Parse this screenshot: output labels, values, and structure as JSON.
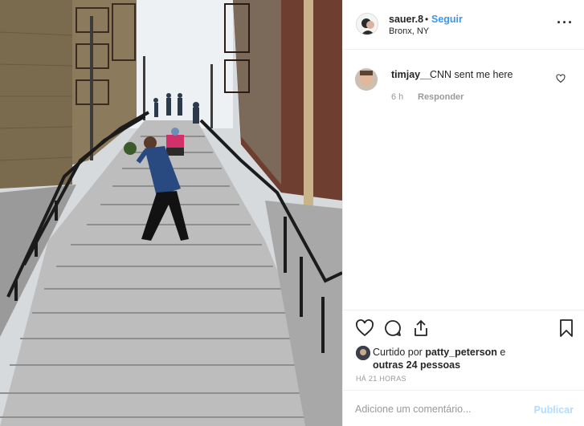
{
  "post": {
    "username": "sauer.8",
    "separator": "•",
    "follow_label": "Seguir",
    "location": "Bronx, NY",
    "more_icon": "more-horizontal-icon",
    "photo_alt": "people on outdoor stairs"
  },
  "comments": [
    {
      "username": "timjay__",
      "text": "CNN sent me here",
      "time": "6 h",
      "reply_label": "Responder"
    }
  ],
  "actions": {
    "like_icon": "heart-icon",
    "comment_icon": "comment-icon",
    "share_icon": "share-icon",
    "save_icon": "bookmark-icon"
  },
  "likes": {
    "prefix": "Curtido por ",
    "user": "patty_peterson",
    "joiner": " e",
    "others": "outras 24 pessoas"
  },
  "time_ago": "HÁ 21 HORAS",
  "add_comment": {
    "placeholder": "Adicione um comentário...",
    "publish_label": "Publicar"
  },
  "colors": {
    "accent": "#3897f0",
    "publish_disabled": "#b3dbff",
    "muted": "#999999"
  }
}
